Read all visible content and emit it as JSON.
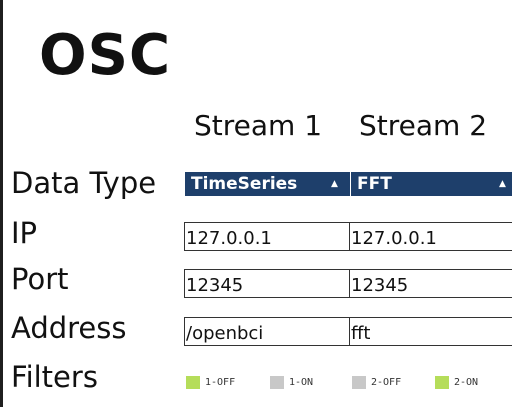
{
  "header": {
    "title": "OSC"
  },
  "columns": {
    "stream1": "Stream 1",
    "stream2": "Stream 2"
  },
  "rows": {
    "data_type_label": "Data Type",
    "ip_label": "IP",
    "port_label": "Port",
    "address_label": "Address",
    "filters_label": "Filters"
  },
  "stream1": {
    "data_type": "TimeSeries",
    "ip": "127.0.0.1",
    "port": "12345",
    "address": "/openbci"
  },
  "stream2": {
    "data_type": "FFT",
    "ip": "127.0.0.1",
    "port": "12345",
    "address": "fft"
  },
  "filters": [
    {
      "label": "1-OFF",
      "active": true
    },
    {
      "label": "1-ON",
      "active": false
    },
    {
      "label": "2-OFF",
      "active": false
    },
    {
      "label": "2-ON",
      "active": true
    }
  ],
  "dropdown_caret": "▲",
  "colors": {
    "dropdown_bg": "#1e3f6b",
    "filter_active": "#b5dd5a",
    "filter_inactive": "#c8c8c8",
    "text": "#111111"
  },
  "icons": {
    "dropdown": "caret-up-icon"
  }
}
